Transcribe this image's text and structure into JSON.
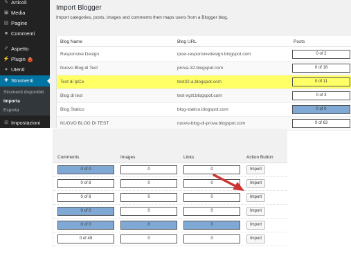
{
  "sidebar": {
    "items": [
      {
        "icon": "pin-icon",
        "label": "Articoli"
      },
      {
        "icon": "media-icon",
        "label": "Media"
      },
      {
        "icon": "page-icon",
        "label": "Pagine"
      },
      {
        "icon": "comment-icon",
        "label": "Commenti"
      },
      {
        "icon": "brush-icon",
        "label": "Aspetto"
      },
      {
        "icon": "plugin-icon",
        "label": "Plugin",
        "badge": "7"
      },
      {
        "icon": "user-icon",
        "label": "Utenti"
      },
      {
        "icon": "wrench-icon",
        "label": "Strumenti"
      },
      {
        "icon": "settings-icon",
        "label": "Impostazioni"
      }
    ],
    "submenu": [
      "Strumenti disponibili",
      "Importa",
      "Esporta"
    ]
  },
  "main": {
    "title": "Import Blogger",
    "description": "Import categories, posts, images and comments then maps users from a Blogger blog."
  },
  "blogs_table": {
    "headers": {
      "name": "Blog Name",
      "url": "Blog URL",
      "posts": "Posts"
    },
    "rows": [
      {
        "name": "Responsive Design",
        "url": "ipcei-responsivedesign.blogspot.com",
        "posts": "0 of 2"
      },
      {
        "name": "Nuovo Blog di Test",
        "url": "prova-32.blogspot.com",
        "posts": "0 of 18"
      },
      {
        "name": "Test di IpCe",
        "url": "test32-a.blogspot.com",
        "posts": "0 of 11"
      },
      {
        "name": "Blog di test",
        "url": "test-xyzt.blogspot.com",
        "posts": "0 of 3"
      },
      {
        "name": "Blog Statico",
        "url": "blog-statico.blogspot.com",
        "posts": "0 of 0"
      },
      {
        "name": "NUOVO BLOG DI TEST",
        "url": "nuovo-blog-di-prova.blogspot.com",
        "posts": "0 of 63"
      }
    ]
  },
  "progress_table": {
    "headers": {
      "comments": "Comments",
      "images": "Images",
      "links": "Links",
      "action": "Action Button"
    },
    "rows": [
      {
        "comments": "0 of 0",
        "images": "0",
        "links": "0",
        "action": "Import"
      },
      {
        "comments": "0 of 8",
        "images": "0",
        "links": "0",
        "action": "Import"
      },
      {
        "comments": "0 of 8",
        "images": "0",
        "links": "0",
        "action": "Import"
      },
      {
        "comments": "0 of 0",
        "images": "0",
        "links": "0",
        "action": "Import"
      },
      {
        "comments": "0 of 0",
        "images": "0",
        "links": "0",
        "action": "Import"
      },
      {
        "comments": "0 of 49",
        "images": "0",
        "links": "0",
        "action": "Import"
      }
    ]
  },
  "colors": {
    "highlight": "#ffff66",
    "progress_blue": "#7fa9d4",
    "sidebar_active": "#0074a2",
    "arrow": "#cc3333"
  }
}
